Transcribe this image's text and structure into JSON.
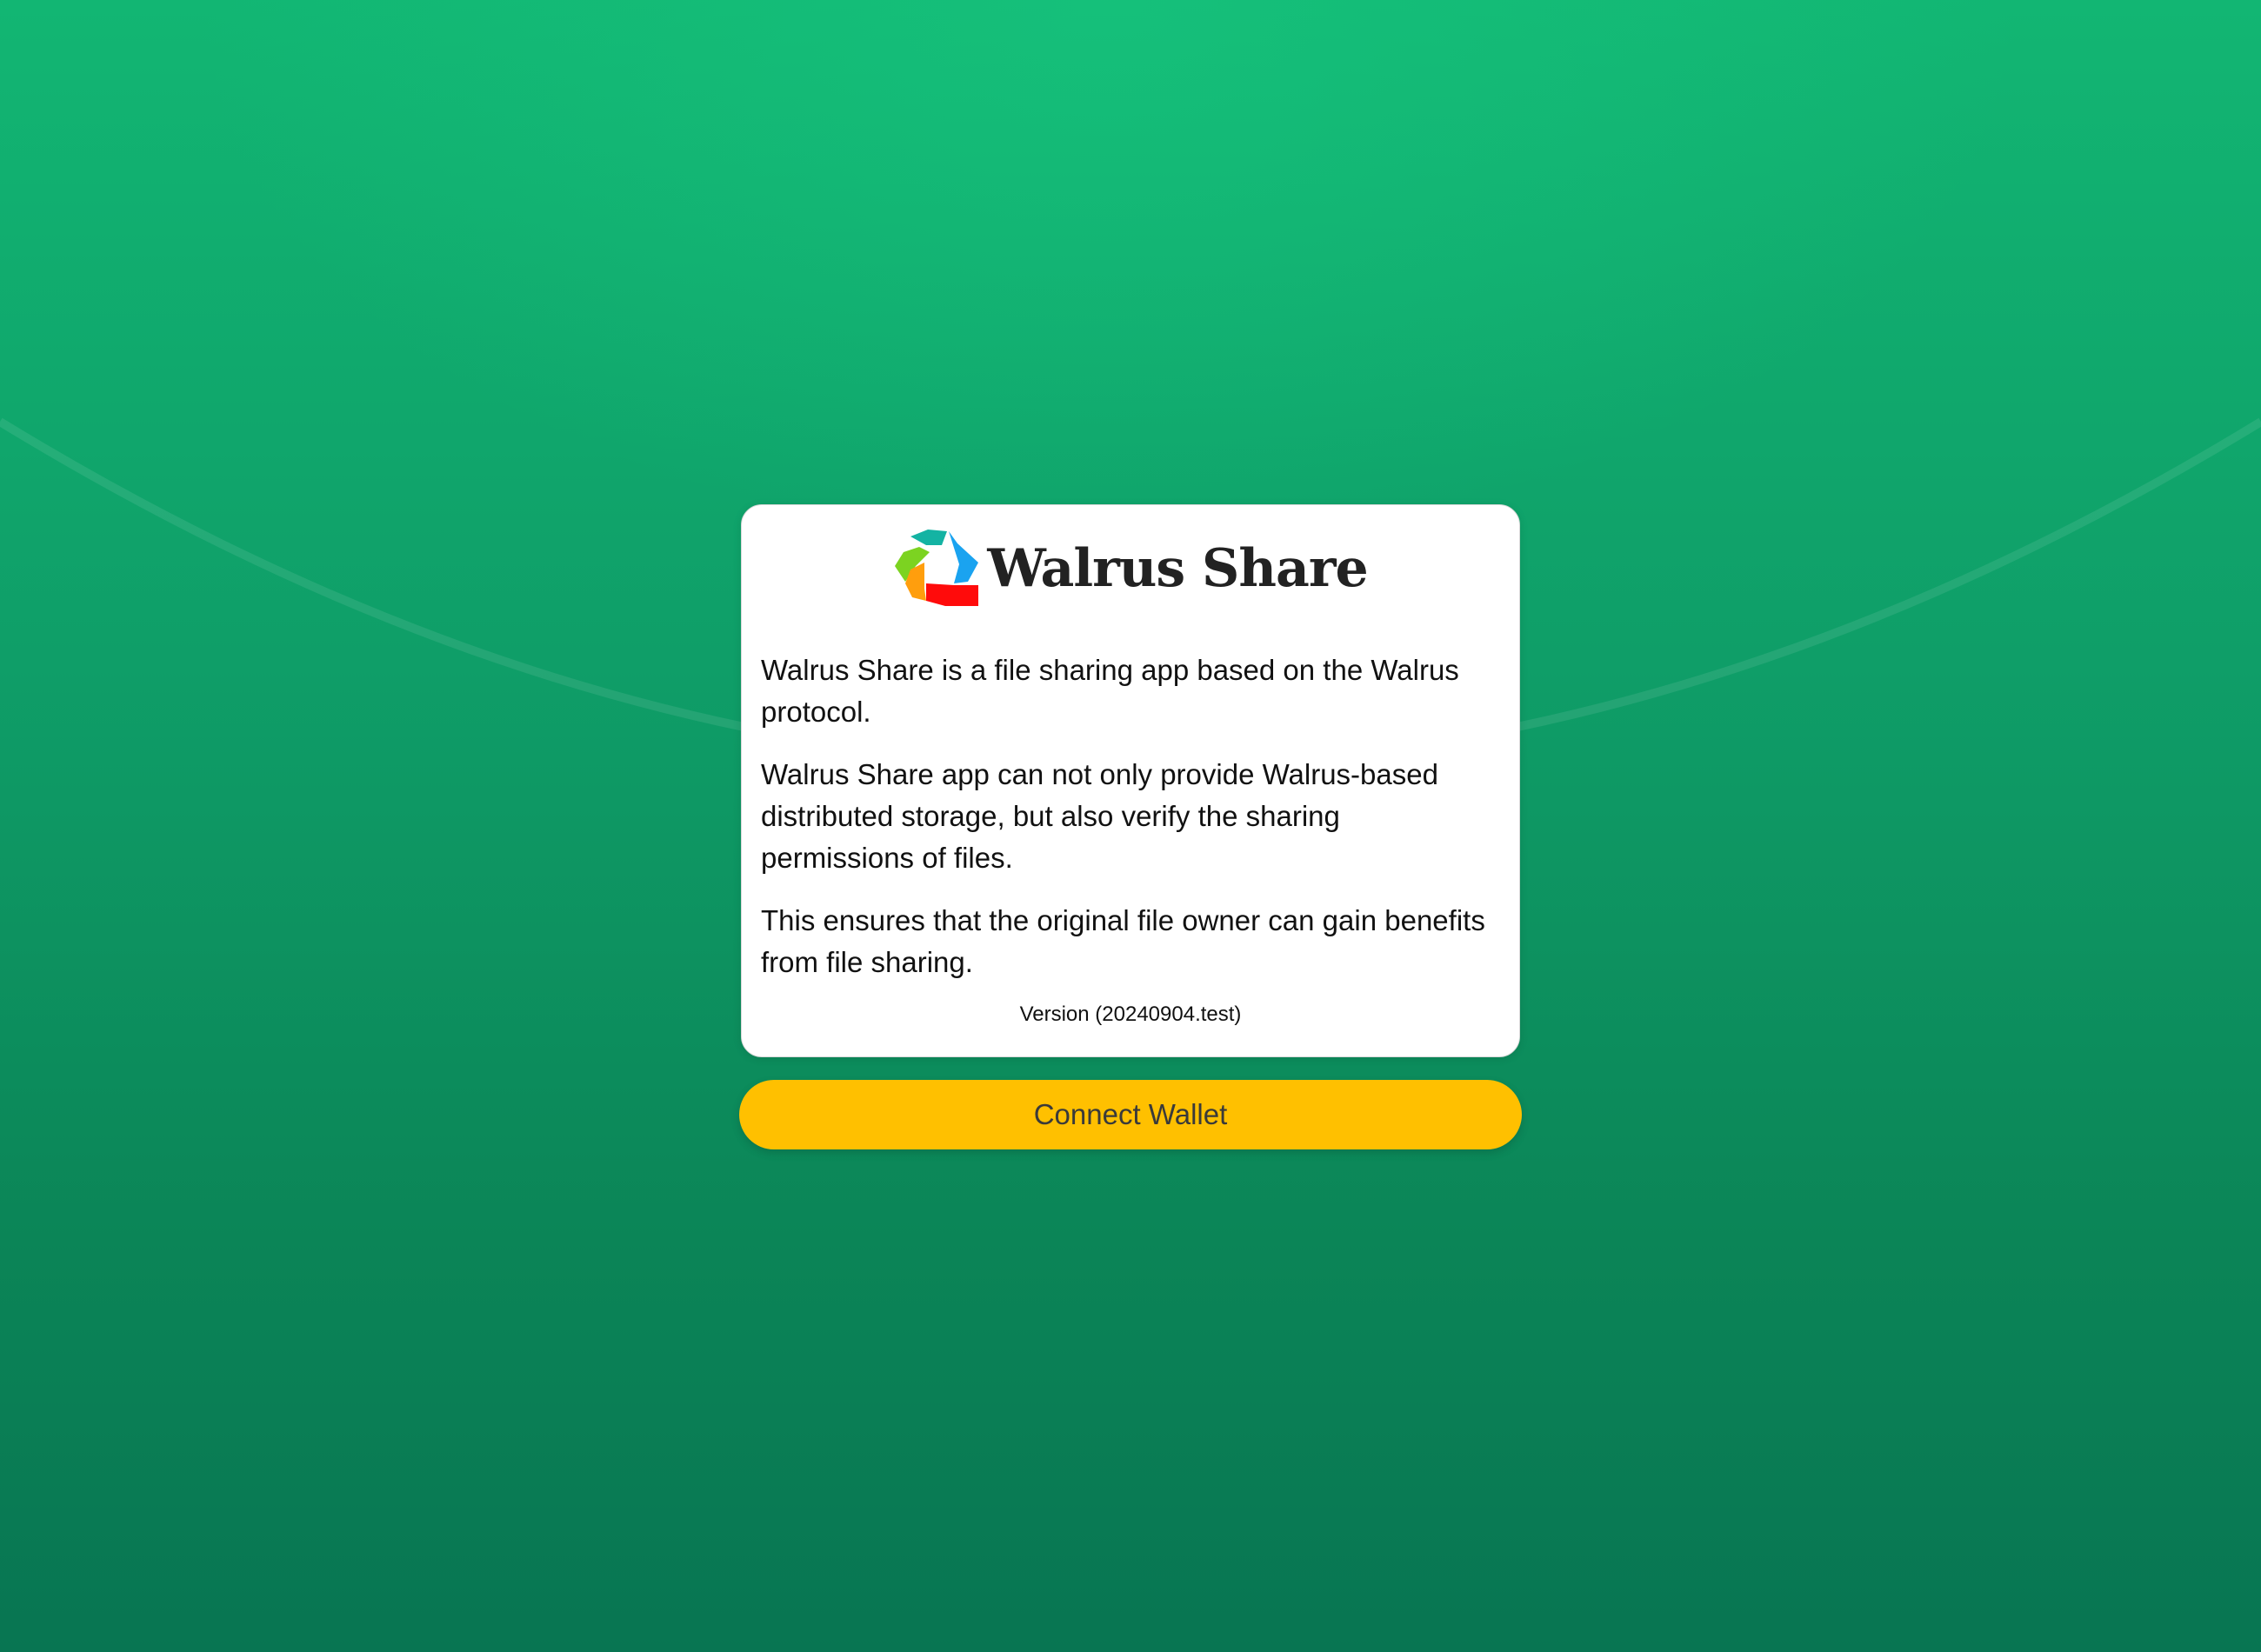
{
  "app": {
    "title": "Walrus Share",
    "logo_icon": "walrus-share-hexagon-logo"
  },
  "description": {
    "paragraphs": [
      "Walrus Share is a file sharing app based on the Walrus protocol.",
      "Walrus Share app can not only provide Walrus-based distributed storage, but also verify the sharing permissions of files.",
      "This ensures that the original file owner can gain benefits from file sharing."
    ]
  },
  "version_label": "Version (20240904.test)",
  "actions": {
    "connect_label": "Connect Wallet"
  },
  "colors": {
    "background_top": "#12b673",
    "background_bottom": "#087552",
    "card": "#ffffff",
    "button": "#ffc000",
    "button_text": "#3a3a3a"
  }
}
